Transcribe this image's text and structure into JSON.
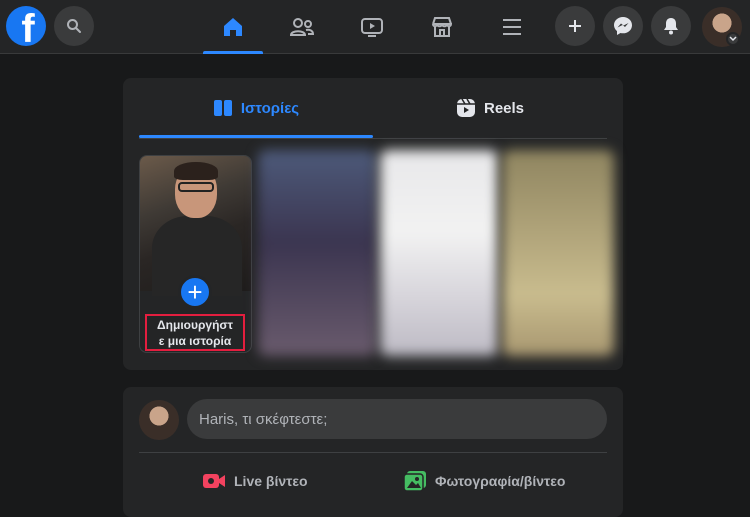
{
  "nav": {
    "logo": "f",
    "tabs": [
      {
        "name": "home",
        "icon": "home-icon",
        "active": true
      },
      {
        "name": "friends",
        "icon": "friends-icon",
        "active": false
      },
      {
        "name": "watch",
        "icon": "video-icon",
        "active": false
      },
      {
        "name": "marketplace",
        "icon": "store-icon",
        "active": false
      },
      {
        "name": "menu",
        "icon": "menu-icon",
        "active": false
      }
    ]
  },
  "stories": {
    "tab_stories": "Ιστορίες",
    "tab_reels": "Reels",
    "create_label_line1": "Δημιουργήστ",
    "create_label_line2": "ε μια ιστορία"
  },
  "composer": {
    "placeholder": "Haris, τι σκέφτεστε;",
    "live_label": "Live βίντεο",
    "photo_label": "Φωτογραφία/βίντεο"
  },
  "colors": {
    "accent": "#2d88ff",
    "brand": "#1877f2",
    "highlight_border": "#e41e3f",
    "live_icon": "#f3425f",
    "photo_icon": "#45bd62"
  }
}
